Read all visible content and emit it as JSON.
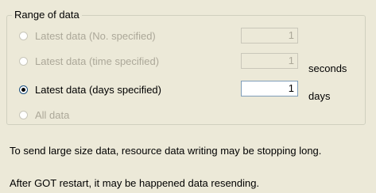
{
  "group": {
    "title": "Range of data"
  },
  "options": [
    {
      "label": "Latest data (No. specified)",
      "value": "1",
      "unit": ""
    },
    {
      "label": "Latest data (time specified)",
      "value": "1",
      "unit": "seconds"
    },
    {
      "label": "Latest data (days specified)",
      "value": "1",
      "unit": "days"
    },
    {
      "label": "All data"
    }
  ],
  "selected_option": "Latest data (days specified)",
  "notes": {
    "line1": "To send large size data, resource data writing may be stopping long.",
    "line2": "After GOT restart, it may be happened data resending."
  }
}
